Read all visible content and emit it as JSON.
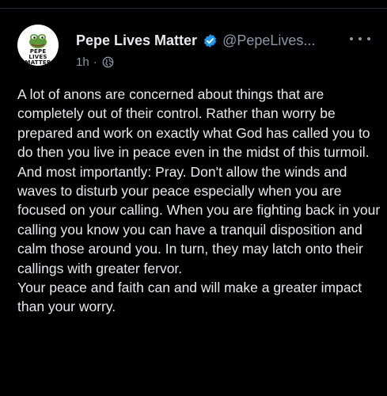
{
  "post": {
    "author": {
      "display_name": "Pepe Lives Matter",
      "handle": "@PepeLives...",
      "avatar_text": [
        "PEPE",
        "LIVES",
        "MATTER"
      ],
      "verified": true
    },
    "timestamp": "1h",
    "meta_separator": "·",
    "audience_icon": "globe-icon",
    "paragraphs": [
      "A lot of anons are concerned about things that are completely out of their control. Rather than worry be prepared and work on exactly what God has called you to do then you live in peace even in the midst of this turmoil. And most importantly: Pray. Don't allow the winds and waves to disturb your peace especially when you are focused on your calling. When you are fighting back in your calling you know you can have a tranquil disposition and calm those around you. In turn, they may latch onto their callings with greater fervor.",
      "Your peace and faith can and will make a greater impact than your worry."
    ]
  },
  "colors": {
    "background": "#000000",
    "text_primary": "#e7e9ea",
    "text_secondary": "#8b98a5",
    "verified_blue": "#1d9bf0"
  }
}
